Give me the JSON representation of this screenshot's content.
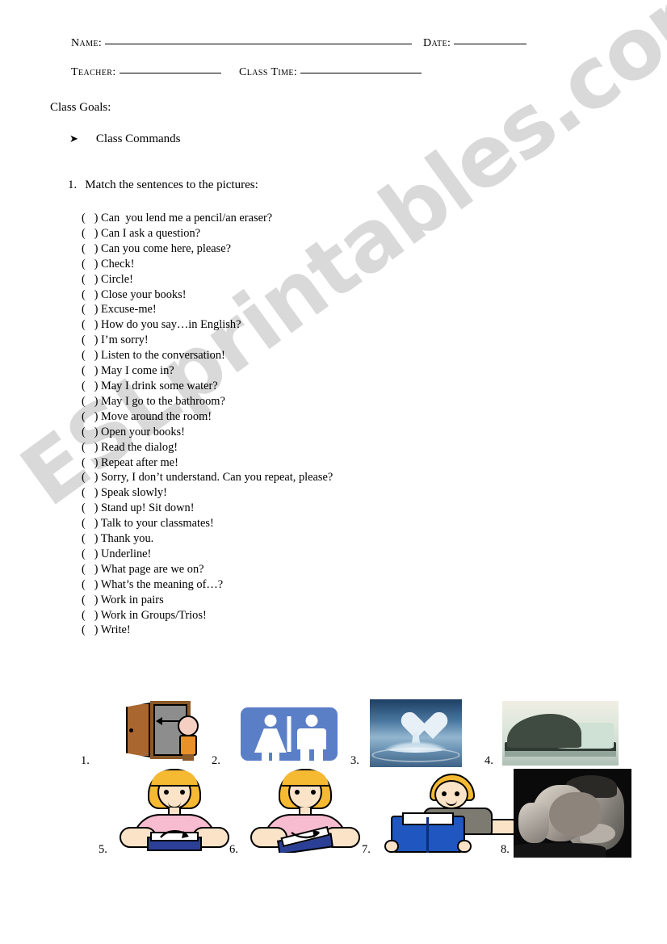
{
  "header": {
    "name_label": "Name:",
    "date_label": "Date:",
    "teacher_label": "Teacher:",
    "class_time_label": "Class Time:",
    "name_value": "",
    "date_value": "",
    "teacher_value": "",
    "class_time_value": ""
  },
  "goals": {
    "heading": "Class Goals:",
    "bullet_glyph": "➤",
    "bullet_text": "Class Commands"
  },
  "task": {
    "number": "1.",
    "instruction": "Match the sentences to the pictures:"
  },
  "sentences": {
    "marker": "(   )",
    "items": [
      "Can  you lend me a pencil/an eraser?",
      "Can I ask a question?",
      "Can you come here, please?",
      "Check!",
      "Circle!",
      "Close your books!",
      "Excuse-me!",
      "How do you say…in English?",
      "I’m sorry!",
      "Listen to the conversation!",
      "May I come in?",
      "May I drink some water?",
      "May I go to the bathroom?",
      "Move around the room!",
      "Open your books!",
      "Read the dialog!",
      "Repeat after me!",
      "Sorry, I don’t understand. Can you repeat, please?",
      "Speak slowly!",
      "Stand up! Sit down!",
      "Talk to your classmates!",
      "Thank you.",
      "Underline!",
      "What page are we on?",
      "What’s the meaning of…?",
      "Work in pairs",
      "Work in Groups/Trios!",
      "Write!"
    ]
  },
  "pictures": [
    {
      "number": "1.",
      "alt": "person entering an open door"
    },
    {
      "number": "2.",
      "alt": "restroom sign with woman and man pictograms"
    },
    {
      "number": "3.",
      "alt": "heart shaped water splash"
    },
    {
      "number": "4.",
      "alt": "open book with turning page"
    },
    {
      "number": "5.",
      "alt": "girl opening a book"
    },
    {
      "number": "6.",
      "alt": "girl closing a book"
    },
    {
      "number": "7.",
      "alt": "boy reading a blue book"
    },
    {
      "number": "8.",
      "alt": "man with oversized ear listening"
    }
  ],
  "watermark": {
    "text": "ESLprintables.com",
    "color": "#d3d3d3"
  },
  "colors": {
    "sign_blue": "#5b7fc7",
    "book_blue": "#1f56c0",
    "hair_yellow": "#f6b932",
    "shirt_pink": "#f7bcd0",
    "door_brown": "#8a5a2b"
  }
}
